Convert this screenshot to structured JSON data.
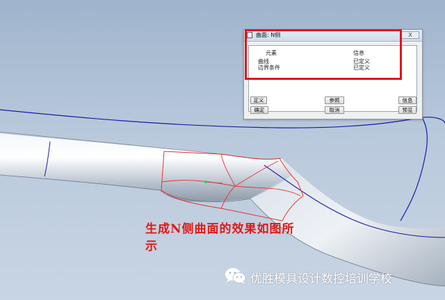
{
  "dialog": {
    "title": "曲面: N侧",
    "close_label": "X",
    "columns": {
      "element": "元素",
      "info": "信息"
    },
    "rows": [
      {
        "label": "曲线",
        "value": "已定义"
      },
      {
        "label": "边界条件",
        "value": "已定义"
      }
    ],
    "buttons": {
      "define": "定义",
      "ok": "确定",
      "reference": "参照",
      "cancel": "取消",
      "info": "信息",
      "preview": "预览"
    }
  },
  "caption": "生成N侧曲面的效果如图所示",
  "watermark": {
    "text": "优胜模具设计数控培训学校",
    "icon": "wechat-icon"
  },
  "colors": {
    "curve": "#1a1aa8",
    "highlight": "#e0141e",
    "surface_edge": "#e83030",
    "background": "#b9c9dc"
  }
}
